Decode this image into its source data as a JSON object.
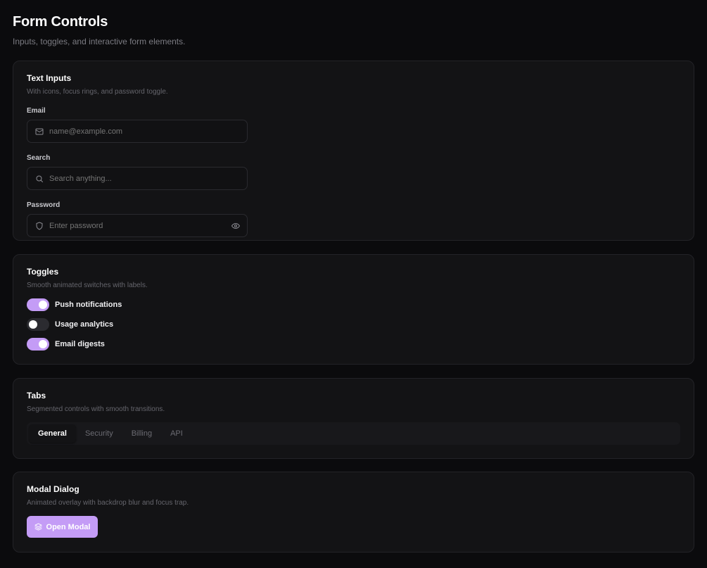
{
  "page": {
    "title": "Form Controls",
    "subtitle": "Inputs, toggles, and interactive form elements."
  },
  "text_inputs": {
    "title": "Text Inputs",
    "description": "With icons, focus rings, and password toggle.",
    "fields": [
      {
        "label": "Email",
        "placeholder": "name@example.com",
        "icon": "mail-icon"
      },
      {
        "label": "Search",
        "placeholder": "Search anything...",
        "icon": "search-icon"
      },
      {
        "label": "Password",
        "placeholder": "Enter password",
        "icon": "shield-icon",
        "trailing_icon": "eye-icon"
      }
    ]
  },
  "toggles": {
    "title": "Toggles",
    "description": "Smooth animated switches with labels.",
    "items": [
      {
        "label": "Push notifications",
        "on": true
      },
      {
        "label": "Usage analytics",
        "on": false
      },
      {
        "label": "Email digests",
        "on": true
      }
    ]
  },
  "tabs": {
    "title": "Tabs",
    "description": "Segmented controls with smooth transitions.",
    "items": [
      "General",
      "Security",
      "Billing",
      "API"
    ],
    "active": "General"
  },
  "modal": {
    "title": "Modal Dialog",
    "description": "Animated overlay with backdrop blur and focus trap.",
    "button_label": "Open Modal",
    "button_icon": "layers-icon"
  },
  "colors": {
    "accent": "#c49cf6",
    "background": "#0b0b0d",
    "card": "#131315",
    "border": "#232327"
  }
}
